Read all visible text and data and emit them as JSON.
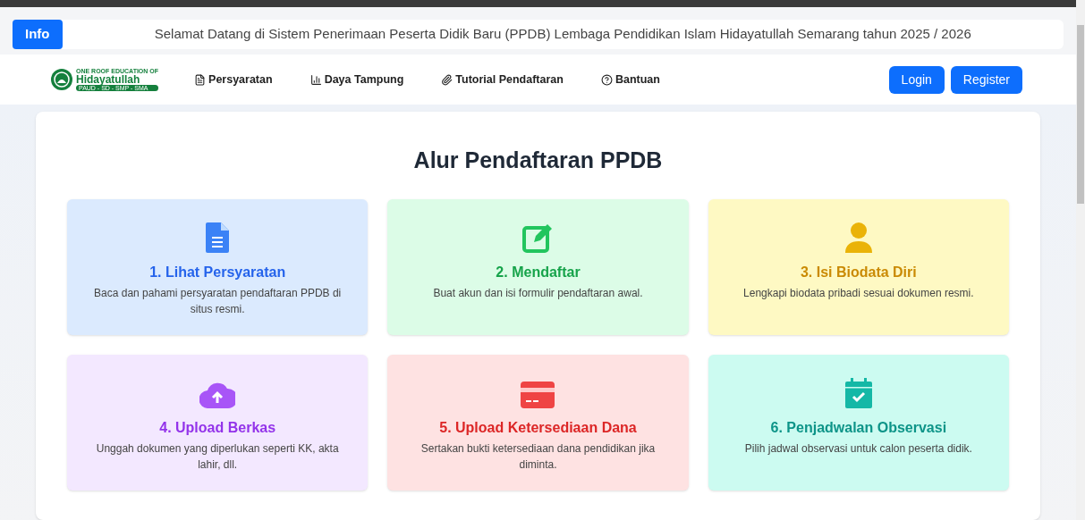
{
  "info_bar": {
    "badge": "Info",
    "message": "Selamat Datang di Sistem Penerimaan Peserta Didik Baru (PPDB) Lembaga Pendidikan Islam Hidayatullah Semarang tahun 2025 / 2026"
  },
  "logo": {
    "tagline": "ONE ROOF EDUCATION OF",
    "name": "Hidayatullah",
    "levels": "PAUD - SD - SMP - SMA"
  },
  "nav": [
    {
      "label": "Persyaratan"
    },
    {
      "label": "Daya Tampung"
    },
    {
      "label": "Tutorial Pendaftaran"
    },
    {
      "label": "Bantuan"
    }
  ],
  "buttons": [
    "Login",
    "Register"
  ],
  "title": "Alur Pendaftaran PPDB",
  "steps": [
    {
      "color": "#2563eb",
      "title": "1. Lihat Persyaratan",
      "text": "Baca dan pahami persyaratan pendaftaran PPDB di situs resmi."
    },
    {
      "color": "#16a34a",
      "title": "2. Mendaftar",
      "text": "Buat akun dan isi formulir pendaftaran awal."
    },
    {
      "color": "#ca8a04",
      "title": "3. Isi Biodata Diri",
      "text": "Lengkapi biodata pribadi sesuai dokumen resmi."
    },
    {
      "color": "#9333ea",
      "title": "4. Upload Berkas",
      "text": "Unggah dokumen yang diperlukan seperti KK, akta lahir, dll."
    },
    {
      "color": "#dc2626",
      "title": "5. Upload Ketersediaan Dana",
      "text": "Sertakan bukti ketersediaan dana pendidikan jika diminta."
    },
    {
      "color": "#0d9488",
      "title": "6. Penjadwalan Observasi",
      "text": "Pilih jadwal observasi untuk calon peserta didik."
    }
  ]
}
